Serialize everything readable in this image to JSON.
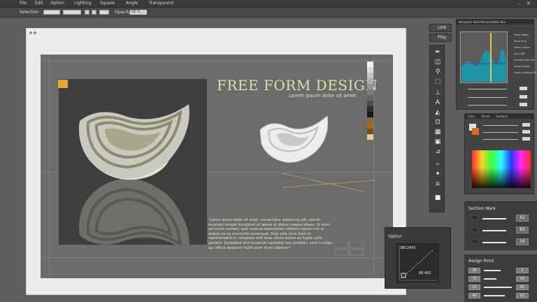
{
  "menu": {
    "items": [
      "File",
      "Edit",
      "Option",
      "Lighting",
      "Square",
      "Angle",
      "Transparent"
    ]
  },
  "window_controls": {
    "close": "✕",
    "minimize": "–"
  },
  "options_bar": {
    "selection_label": "Selection",
    "opacity_label": "Opacity",
    "opacity_value": "59 %"
  },
  "canvas": {
    "title": "FREE FORM DESIGN",
    "subtitle": "Lorem ipsum dolor sit amet",
    "body_text": "\"Lorem ipsum dolor sit amet, consectetur adipiscing elit, sed do eiusmod tempor incididunt ut labore et dolore magna aliqua. Ut enim ad minim veniam, quis nostrud exercitation ullamco laboris nisi ut aliquip ex ea commodo consequat. Duis aute irure dolor in reprehenderit in voluptate velit esse cillum dolore eu fugiat nulla pariatur. Excepteur sint occaecat cupidatat non proident, sunt in culpa qui officia deserunt mollit anim id est laborum\"",
    "accent_color": "#e1a93a",
    "swatch_colors": [
      "#f4f4f4",
      "#dcdcdc",
      "#c4c4c4",
      "#acacac",
      "#949494",
      "#7c7c7c",
      "#646464",
      "#4c4c4c",
      "#2c2c2c",
      "#181818",
      "#8a6a3a",
      "#a06a20",
      "#7a4a18",
      "#d8cda0"
    ]
  },
  "toolbar": {
    "link_label": "Link",
    "play_label": "Play",
    "tools": [
      "pen-icon",
      "shapes-icon",
      "zoom-icon",
      "select-icon",
      "eyedropper-icon",
      "text-icon",
      "bucket-icon",
      "crop-icon",
      "grid-icon",
      "layers-icon",
      "measure-icon",
      "brush-icon",
      "gradient-icon",
      "stamp-icon",
      "blur-icon",
      "fill-icon"
    ]
  },
  "navigator_panel": {
    "tabs": [
      "Navigator",
      "Back/Histories",
      "Hide Nav"
    ],
    "checkbox_labels": [
      "Show Edges",
      "Show Grid",
      "Match Colors",
      "Sync Diff",
      "Sharpen Dist Rel.",
      "Show Guides",
      "Paste Scrolling Pro"
    ],
    "histogram_fill": "#1d93a6",
    "marker_color": "#f1c430"
  },
  "color_panel": {
    "tabs": [
      "Color",
      "Brush",
      "Symbols"
    ]
  },
  "option_panel": {
    "title": "Option",
    "value_top": "38C2455",
    "value_bottom": "88.462"
  },
  "section_mark": {
    "title": "Section Mark",
    "values": [
      "42",
      "83",
      "34"
    ]
  },
  "assign_point": {
    "title": "Assign Point",
    "left_values": [
      "38",
      "72",
      "21",
      "40"
    ],
    "right_values": [
      "2",
      "43",
      "81",
      "62"
    ]
  }
}
